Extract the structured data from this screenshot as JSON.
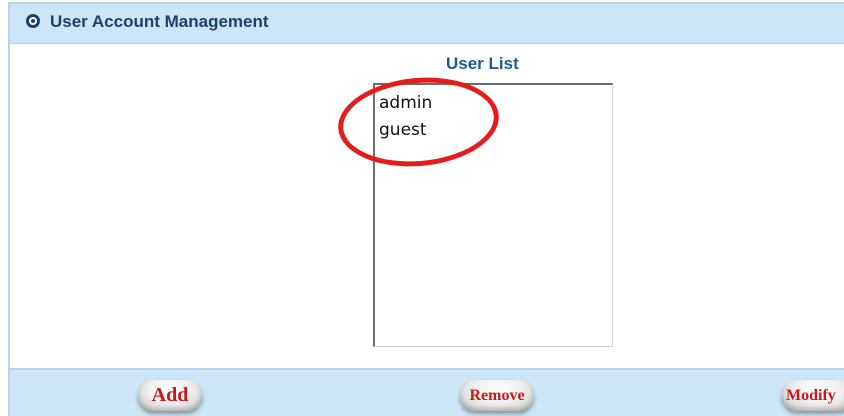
{
  "header": {
    "title": "User Account Management",
    "icon": "circle-target-icon"
  },
  "user_list": {
    "title": "User List",
    "items": [
      "admin",
      "guest"
    ]
  },
  "buttons": {
    "add": "Add",
    "remove": "Remove",
    "modify": "Modify"
  },
  "colors": {
    "panel_background": "#cce6f7",
    "title_text": "#1e3f6a",
    "list_title_text": "#1e5a99",
    "button_text": "#c91818",
    "annotation": "#e51c1c"
  }
}
